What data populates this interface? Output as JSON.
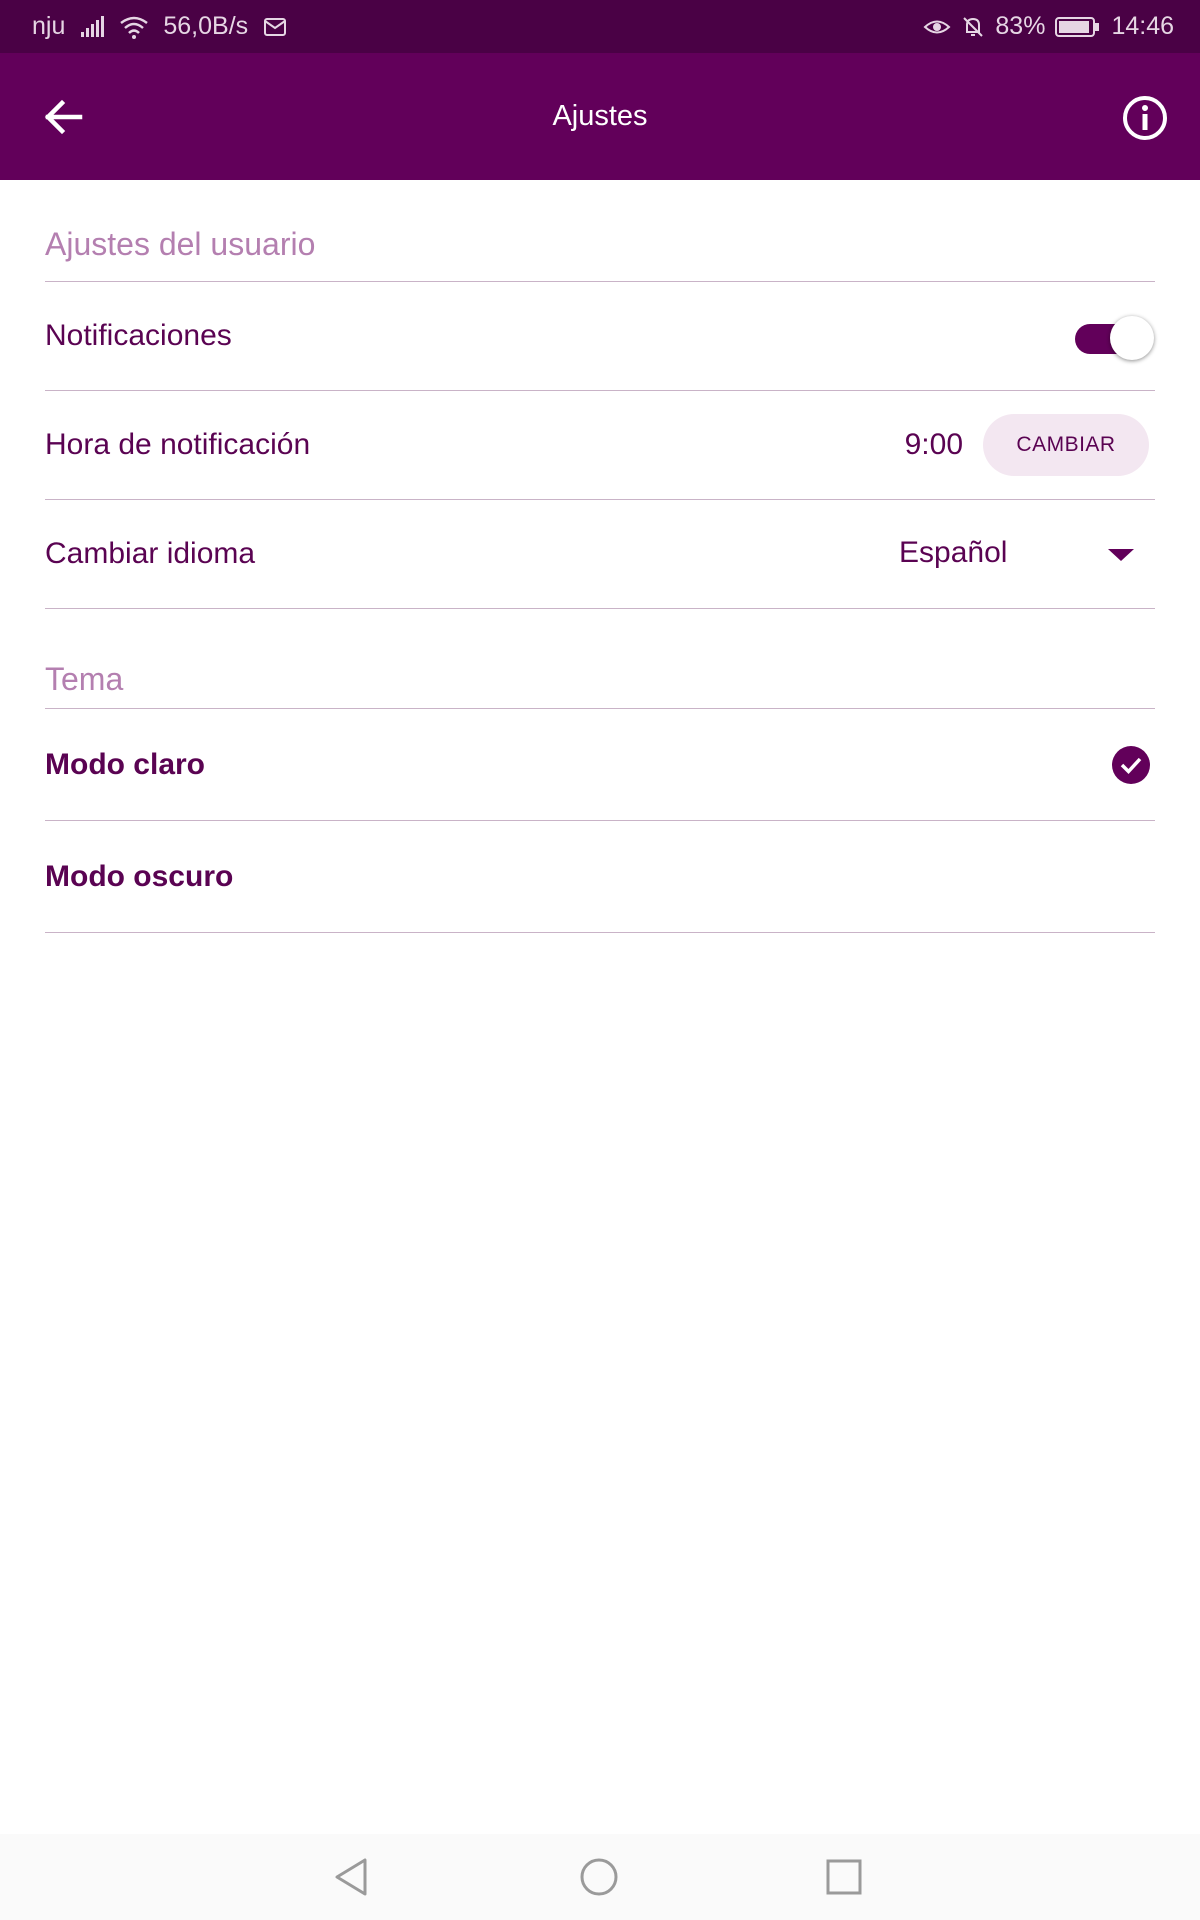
{
  "status_bar": {
    "carrier": "nju",
    "speed": "56,0B/s",
    "battery": "83%",
    "time": "14:46",
    "icons": [
      "signal-icon",
      "wifi-icon",
      "notification-icon",
      "eye-icon",
      "bell-off-icon",
      "battery-icon"
    ]
  },
  "app_bar": {
    "title": "Ajustes",
    "back_icon": "arrow-left-icon",
    "info_icon": "info-circle-icon"
  },
  "user_settings": {
    "header": "Ajustes del usuario",
    "notifications": {
      "label": "Notificaciones",
      "enabled": true
    },
    "notification_time": {
      "label": "Hora de notificación",
      "value": "9:00",
      "button": "CAMBIAR"
    },
    "language": {
      "label": "Cambiar idioma",
      "selected": "Español"
    }
  },
  "theme": {
    "header": "Tema",
    "options": [
      {
        "label": "Modo claro",
        "selected": true
      },
      {
        "label": "Modo oscuro",
        "selected": false
      }
    ]
  },
  "nav_bar": {
    "icons": [
      "back-triangle-icon",
      "home-circle-icon",
      "recents-square-icon"
    ]
  },
  "colors": {
    "primary": "#62005a",
    "status_bar": "#4a0145",
    "section_header_text": "#b47fb0",
    "row_text": "#5a0352",
    "button_bg": "#f3e7f1",
    "divider": "#c9b3c7"
  }
}
